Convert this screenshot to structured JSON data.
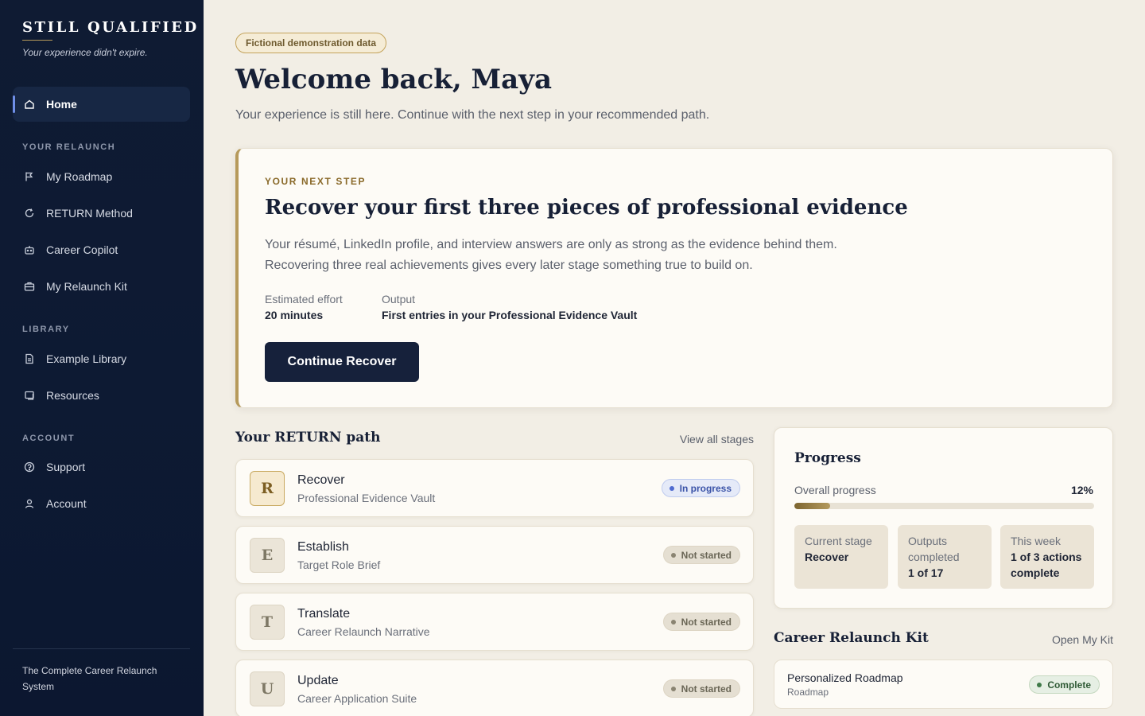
{
  "brand": {
    "title": "STILL QUALIFIED",
    "tagline": "Your experience didn't expire."
  },
  "sidebar": {
    "home": {
      "label": "Home",
      "icon": "home-icon"
    },
    "sections": [
      {
        "title": "YOUR RELAUNCH",
        "items": [
          {
            "label": "My Roadmap",
            "icon": "roadmap-flag-icon"
          },
          {
            "label": "RETURN Method",
            "icon": "refresh-icon"
          },
          {
            "label": "Career Copilot",
            "icon": "robot-icon"
          },
          {
            "label": "My Relaunch Kit",
            "icon": "briefcase-icon"
          }
        ]
      },
      {
        "title": "LIBRARY",
        "items": [
          {
            "label": "Example Library",
            "icon": "document-icon"
          },
          {
            "label": "Resources",
            "icon": "book-icon"
          }
        ]
      },
      {
        "title": "ACCOUNT",
        "items": [
          {
            "label": "Support",
            "icon": "help-circle-icon"
          },
          {
            "label": "Account",
            "icon": "user-icon"
          }
        ]
      }
    ],
    "footer": "The Complete Career Relaunch System",
    "active_accent": "#6f8fe8"
  },
  "header": {
    "badge": "Fictional demonstration data",
    "title": "Welcome back, Maya",
    "subtitle": "Your experience is still here. Continue with the next step in your recommended path."
  },
  "next_step": {
    "eyebrow": "YOUR NEXT STEP",
    "title": "Recover your first three pieces of professional evidence",
    "body": "Your résumé, LinkedIn profile, and interview answers are only as strong as the evidence behind them. Recovering three real achievements gives every later stage something true to build on.",
    "effort_label": "Estimated effort",
    "effort_value": "20 minutes",
    "output_label": "Output",
    "output_value": "First entries in your Professional Evidence Vault",
    "button": "Continue Recover"
  },
  "path": {
    "title": "Your RETURN path",
    "link": "View all stages",
    "stages": [
      {
        "letter": "R",
        "name": "Recover",
        "output": "Professional Evidence Vault",
        "status": "In progress"
      },
      {
        "letter": "E",
        "name": "Establish",
        "output": "Target Role Brief",
        "status": "Not started"
      },
      {
        "letter": "T",
        "name": "Translate",
        "output": "Career Relaunch Narrative",
        "status": "Not started"
      },
      {
        "letter": "U",
        "name": "Update",
        "output": "Career Application Suite",
        "status": "Not started"
      }
    ]
  },
  "progress": {
    "title": "Progress",
    "overall_label": "Overall progress",
    "overall_value": "12%",
    "overall_fraction": 0.12,
    "stats": [
      {
        "label": "Current stage",
        "value": "Recover"
      },
      {
        "label": "Outputs completed",
        "value": "1 of 17"
      },
      {
        "label": "This week",
        "value": "1 of 3 actions complete"
      }
    ]
  },
  "kit": {
    "title": "Career Relaunch Kit",
    "link": "Open My Kit",
    "items": [
      {
        "name": "Personalized Roadmap",
        "type": "Roadmap",
        "status": "Complete"
      }
    ]
  },
  "colors": {
    "navy": "#16213b",
    "gold": "#b69a5b",
    "in_progress": "#3b54a8",
    "complete": "#2f5a35"
  }
}
